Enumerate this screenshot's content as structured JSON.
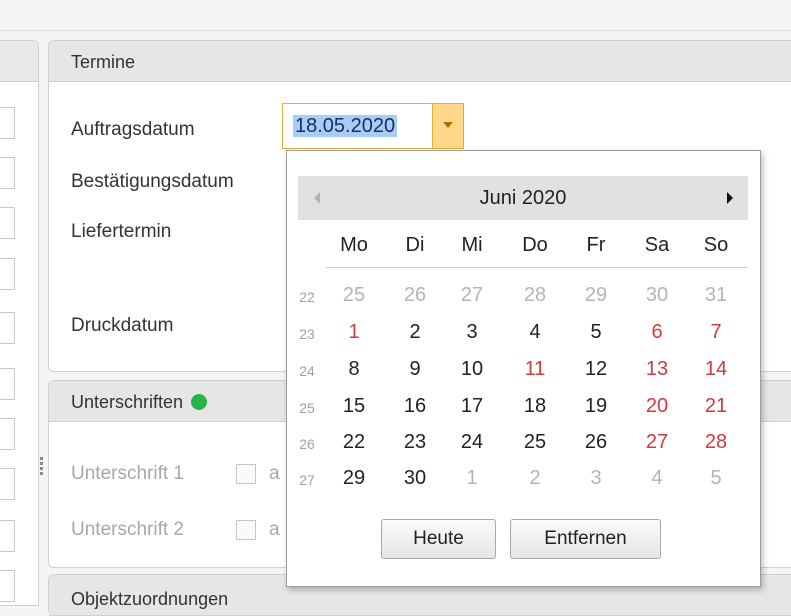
{
  "sections": {
    "termine": {
      "title": "Termine",
      "fields": [
        {
          "label": "Auftragsdatum"
        },
        {
          "label": "Bestätigungsdatum"
        },
        {
          "label": "Liefertermin"
        },
        {
          "label": "Druckdatum"
        }
      ],
      "date_value": "18.05.2020"
    },
    "unterschriften": {
      "title": "Unterschriften",
      "status_color": "#27b34a",
      "rows": [
        {
          "label": "Unterschrift 1",
          "checkbox_text": "a"
        },
        {
          "label": "Unterschrift 2",
          "checkbox_text": "a"
        }
      ]
    },
    "objektzuordnungen": {
      "title": "Objektzuordnungen"
    }
  },
  "calendar": {
    "month_label": "Juni 2020",
    "day_headers": [
      "Mo",
      "Di",
      "Mi",
      "Do",
      "Fr",
      "Sa",
      "So"
    ],
    "weeks": [
      {
        "wk": "22",
        "days": [
          {
            "d": "25",
            "t": "other"
          },
          {
            "d": "26",
            "t": "other"
          },
          {
            "d": "27",
            "t": "other"
          },
          {
            "d": "28",
            "t": "other"
          },
          {
            "d": "29",
            "t": "other"
          },
          {
            "d": "30",
            "t": "other"
          },
          {
            "d": "31",
            "t": "other"
          }
        ]
      },
      {
        "wk": "23",
        "days": [
          {
            "d": "1",
            "t": "holiday"
          },
          {
            "d": "2",
            "t": "normal"
          },
          {
            "d": "3",
            "t": "normal"
          },
          {
            "d": "4",
            "t": "normal"
          },
          {
            "d": "5",
            "t": "normal"
          },
          {
            "d": "6",
            "t": "weekend"
          },
          {
            "d": "7",
            "t": "weekend"
          }
        ]
      },
      {
        "wk": "24",
        "days": [
          {
            "d": "8",
            "t": "normal"
          },
          {
            "d": "9",
            "t": "normal"
          },
          {
            "d": "10",
            "t": "normal"
          },
          {
            "d": "11",
            "t": "holiday"
          },
          {
            "d": "12",
            "t": "normal"
          },
          {
            "d": "13",
            "t": "weekend"
          },
          {
            "d": "14",
            "t": "weekend"
          }
        ]
      },
      {
        "wk": "25",
        "days": [
          {
            "d": "15",
            "t": "normal"
          },
          {
            "d": "16",
            "t": "normal"
          },
          {
            "d": "17",
            "t": "normal"
          },
          {
            "d": "18",
            "t": "normal"
          },
          {
            "d": "19",
            "t": "normal"
          },
          {
            "d": "20",
            "t": "weekend"
          },
          {
            "d": "21",
            "t": "weekend"
          }
        ]
      },
      {
        "wk": "26",
        "days": [
          {
            "d": "22",
            "t": "normal"
          },
          {
            "d": "23",
            "t": "normal"
          },
          {
            "d": "24",
            "t": "normal"
          },
          {
            "d": "25",
            "t": "normal"
          },
          {
            "d": "26",
            "t": "normal"
          },
          {
            "d": "27",
            "t": "weekend"
          },
          {
            "d": "28",
            "t": "weekend"
          }
        ]
      },
      {
        "wk": "27",
        "days": [
          {
            "d": "29",
            "t": "normal"
          },
          {
            "d": "30",
            "t": "normal"
          },
          {
            "d": "1",
            "t": "other"
          },
          {
            "d": "2",
            "t": "other"
          },
          {
            "d": "3",
            "t": "other"
          },
          {
            "d": "4",
            "t": "other"
          },
          {
            "d": "5",
            "t": "other"
          }
        ]
      }
    ],
    "buttons": {
      "today": "Heute",
      "clear": "Entfernen"
    }
  },
  "colors": {
    "weekend_holiday": "#d23a3a",
    "selection": "#a9cdf2",
    "dropdown_accent": "#ffd88a"
  }
}
